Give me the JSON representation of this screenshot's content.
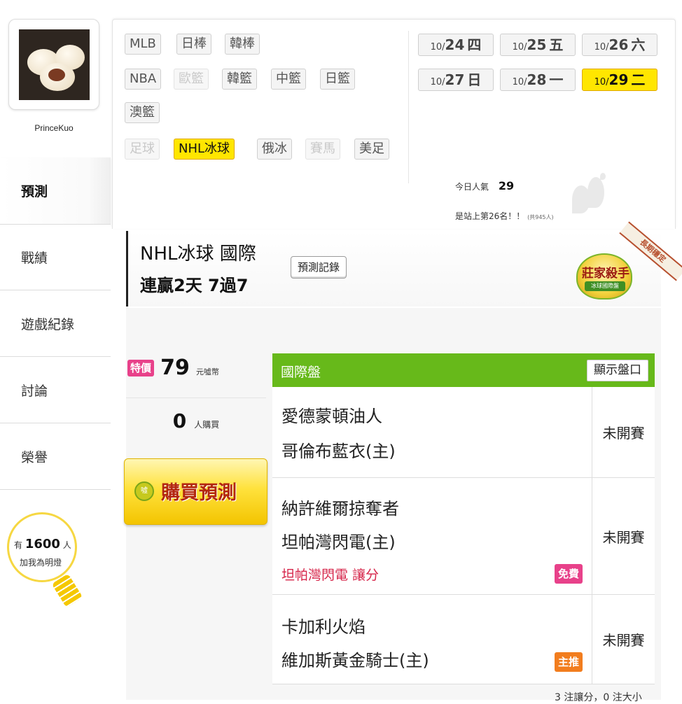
{
  "user": {
    "name": "PrinceKuo"
  },
  "nav": {
    "items": [
      {
        "label": "預測",
        "active": true
      },
      {
        "label": "戰績",
        "active": false
      },
      {
        "label": "遊戲紀錄",
        "active": false
      },
      {
        "label": "討論",
        "active": false
      },
      {
        "label": "榮譽",
        "active": false
      }
    ]
  },
  "fans": {
    "prefix": "有",
    "count": "1600",
    "suffix": "人",
    "action": "加我為明燈"
  },
  "leagues": [
    {
      "label": "MLB",
      "state": "normal"
    },
    {
      "label": "日棒",
      "state": "normal"
    },
    {
      "label": "韓棒",
      "state": "normal"
    },
    {
      "label": "NBA",
      "state": "normal"
    },
    {
      "label": "歐籃",
      "state": "disabled"
    },
    {
      "label": "韓籃",
      "state": "normal"
    },
    {
      "label": "中籃",
      "state": "normal"
    },
    {
      "label": "日籃",
      "state": "normal"
    },
    {
      "label": "澳籃",
      "state": "normal"
    },
    {
      "label": "足球",
      "state": "disabled"
    },
    {
      "label": "NHL冰球",
      "state": "selected"
    },
    {
      "label": "俄冰",
      "state": "normal"
    },
    {
      "label": "賽馬",
      "state": "disabled"
    },
    {
      "label": "美足",
      "state": "normal"
    }
  ],
  "dates": [
    {
      "md": "10/",
      "day": "24",
      "weekday": "四",
      "selected": false
    },
    {
      "md": "10/",
      "day": "25",
      "weekday": "五",
      "selected": false
    },
    {
      "md": "10/",
      "day": "26",
      "weekday": "六",
      "selected": false
    },
    {
      "md": "10/",
      "day": "27",
      "weekday": "日",
      "selected": false
    },
    {
      "md": "10/",
      "day": "28",
      "weekday": "一",
      "selected": false
    },
    {
      "md": "10/",
      "day": "29",
      "weekday": "二",
      "selected": true
    }
  ],
  "popularity": {
    "label": "今日人氣",
    "value": "29",
    "rank_text": "是站上第26名！！",
    "total_text": "(共945人)"
  },
  "header": {
    "line1": "NHL冰球 國際",
    "line2": "連贏2天 7過7",
    "record_button": "預測記錄",
    "badge_title": "莊家殺手",
    "badge_sub": "冰球國際盤",
    "ribbon": "長期穩定"
  },
  "purchase": {
    "special_label": "特價",
    "price": "79",
    "price_unit": "元噓幣",
    "buyers": "0",
    "buyers_unit": "人購買",
    "buy_button": "購買預測",
    "coin_label": "噓"
  },
  "games": {
    "title": "國際盤",
    "show_odds": "顯示盤口",
    "rows": [
      {
        "away": "愛德蒙頓油人",
        "home": "哥倫布藍衣(主)",
        "status": "未開賽",
        "pick": "",
        "badge": ""
      },
      {
        "away": "納許維爾掠奪者",
        "home": "坦帕灣閃電(主)",
        "status": "未開賽",
        "pick": "坦帕灣閃電 讓分",
        "badge": "免費"
      },
      {
        "away": "卡加利火焰",
        "home": "維加斯黃金騎士(主)",
        "status": "未開賽",
        "pick": "",
        "badge": "主推"
      }
    ]
  },
  "summary": "3 注讓分，0 注大小",
  "colors": {
    "accent_green": "#67b91a",
    "highlight_yellow": "#ffe600",
    "pink": "#e8418a",
    "orange": "#f27d1e",
    "pick_red": "#d6254a"
  }
}
